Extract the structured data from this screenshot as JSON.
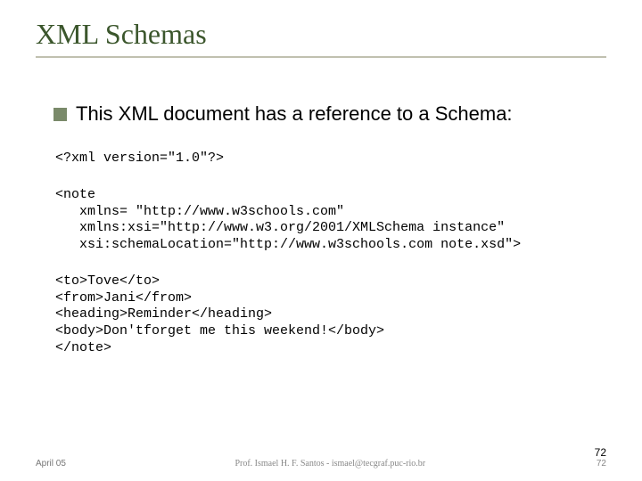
{
  "title": "XML Schemas",
  "bullet": "This XML document has a reference to a Schema:",
  "code": {
    "decl": "<?xml version=\"1.0\"?>",
    "note_open": "<note\n   xmlns= \"http://www.w3schools.com\"\n   xmlns:xsi=\"http://www.w3.org/2001/XMLSchema instance\"\n   xsi:schemaLocation=\"http://www.w3schools.com note.xsd\">",
    "body": "<to>Tove</to>\n<from>Jani</from>\n<heading>Reminder</heading>\n<body>Don'tforget me this weekend!</body>\n</note>"
  },
  "footer": {
    "date": "April 05",
    "author": "Prof. Ismael H. F. Santos -  ismael@tecgraf.puc-rio.br",
    "page_a": "72",
    "page_b": "72"
  }
}
